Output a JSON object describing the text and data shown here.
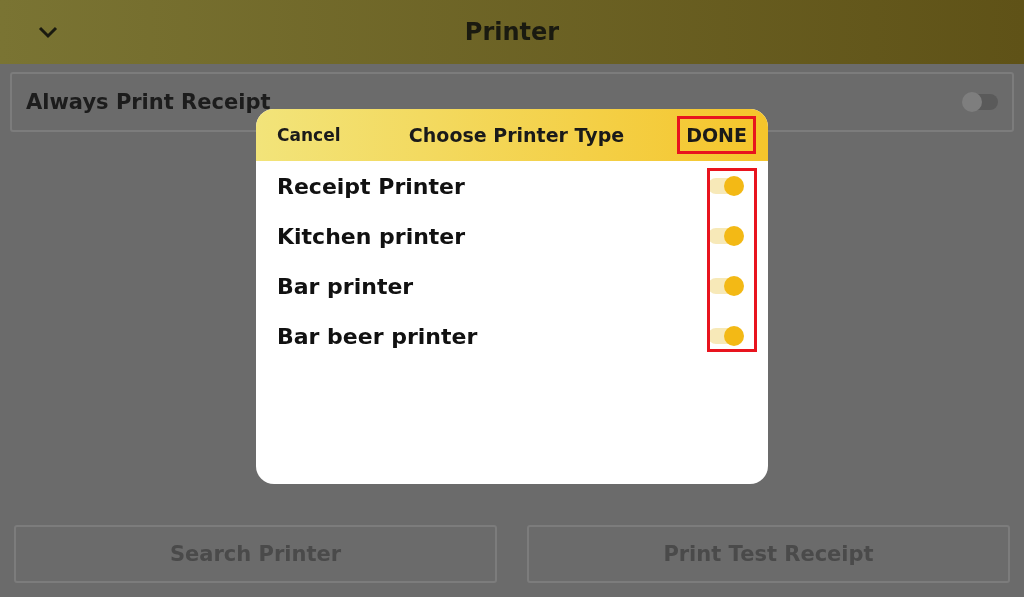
{
  "header": {
    "title": "Printer"
  },
  "settings": [
    {
      "label": "Always Print Receipt",
      "on": false
    }
  ],
  "buttons": [
    "Search Printer",
    "Print Test Receipt"
  ],
  "dialog": {
    "cancel": "Cancel",
    "title": "Choose Printer Type",
    "done": "DONE",
    "done_highlighted": true,
    "toggles_highlighted": true,
    "printer_types": [
      {
        "label": "Receipt Printer",
        "on": true
      },
      {
        "label": "Kitchen printer",
        "on": true
      },
      {
        "label": "Bar printer",
        "on": true
      },
      {
        "label": "Bar beer printer",
        "on": true
      }
    ]
  }
}
